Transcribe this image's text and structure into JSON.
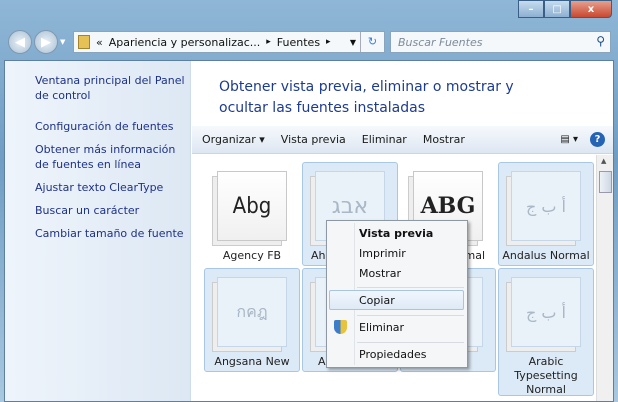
{
  "window": {
    "minimize": "–",
    "maximize": "□",
    "close": "x"
  },
  "address": {
    "prefix": "«",
    "crumbs": [
      "Apariencia y personalizac...",
      "Fuentes"
    ],
    "sep": "▸"
  },
  "search": {
    "placeholder": "Buscar Fuentes"
  },
  "sidebar": {
    "items": [
      {
        "label": "Ventana principal del Panel de control"
      },
      {
        "label": "Configuración de fuentes"
      },
      {
        "label": "Obtener más información de fuentes en línea"
      },
      {
        "label": "Ajustar texto ClearType"
      },
      {
        "label": "Buscar un carácter"
      },
      {
        "label": "Cambiar tamaño de fuente"
      }
    ]
  },
  "main": {
    "title": "Obtener vista previa, eliminar o mostrar y ocultar las fuentes instaladas"
  },
  "toolbar": {
    "organize": "Organizar ▾",
    "preview": "Vista previa",
    "delete": "Eliminar",
    "show": "Mostrar",
    "help": "?"
  },
  "fonts": [
    {
      "name": "Agency FB",
      "sample": "Abg"
    },
    {
      "name": "Aha",
      "sample": "אבג"
    },
    {
      "name": "mal",
      "sample": "ABG"
    },
    {
      "name": "Andalus Normal",
      "sample": "أ ب ج"
    },
    {
      "name": "Angsana New",
      "sample": "กคฎ"
    },
    {
      "name": "Ar",
      "sample": ""
    },
    {
      "name": "",
      "sample": ""
    },
    {
      "name": "Arabic Typesetting Normal",
      "sample": "أ ب ج"
    }
  ],
  "context_menu": {
    "items": [
      "Vista previa",
      "Imprimir",
      "Mostrar",
      "Copiar",
      "Eliminar",
      "Propiedades"
    ]
  }
}
